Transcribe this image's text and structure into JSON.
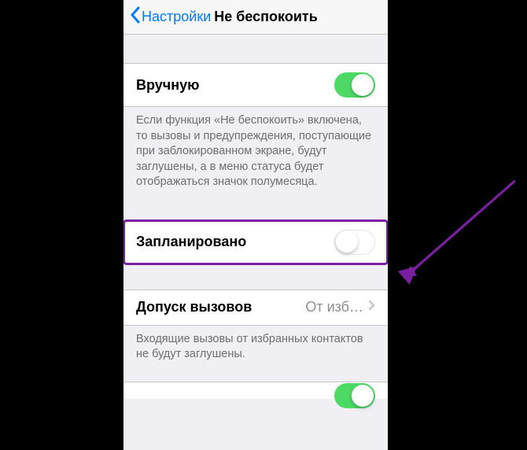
{
  "nav": {
    "back_label": "Настройки",
    "title": "Не беспокоить"
  },
  "rows": {
    "manual": {
      "label": "Вручную",
      "on": true
    },
    "manual_footer": "Если функция «Не беспокоить» включена, то вызовы и предупреждения, поступающие при заблокированном экране, будут заглушены, а в меню статуса будет отображаться значок полумесяца.",
    "scheduled": {
      "label": "Запланировано",
      "on": false
    },
    "allow_calls": {
      "label": "Допуск вызовов",
      "value": "От изб…"
    },
    "allow_calls_footer": "Входящие вызовы от избранных контактов не будут заглушены."
  },
  "annotation": {
    "color": "#7b1fa2"
  }
}
